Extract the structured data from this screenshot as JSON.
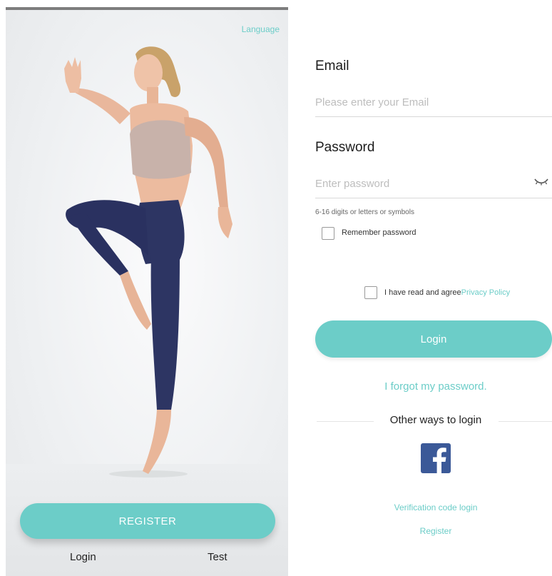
{
  "colors": {
    "accent": "#6ccdc8",
    "text": "#222222",
    "placeholder": "#bdbdbd",
    "facebook": "#3b5998"
  },
  "welcome_screen": {
    "language_label": "Language",
    "register_label": "REGISTER",
    "login_label": "Login",
    "test_label": "Test",
    "hero_image": "woman-jumping-athlete"
  },
  "login_screen": {
    "email": {
      "label": "Email",
      "placeholder": "Please enter your Email",
      "value": ""
    },
    "password": {
      "label": "Password",
      "placeholder": "Enter password",
      "value": "",
      "toggle_icon": "eye-closed-icon",
      "hint": "6-16 digits or letters or symbols"
    },
    "remember_label": "Remember password",
    "remember_checked": false,
    "agree_text": "I have read and agree",
    "privacy_policy_label": "Privacy Policy",
    "agree_checked": false,
    "login_button_label": "Login",
    "forgot_password_label": "I forgot my password.",
    "other_ways_label": "Other ways to login",
    "social_icon": "facebook-icon",
    "verification_login_label": "Verification code login",
    "register_label": "Register"
  }
}
